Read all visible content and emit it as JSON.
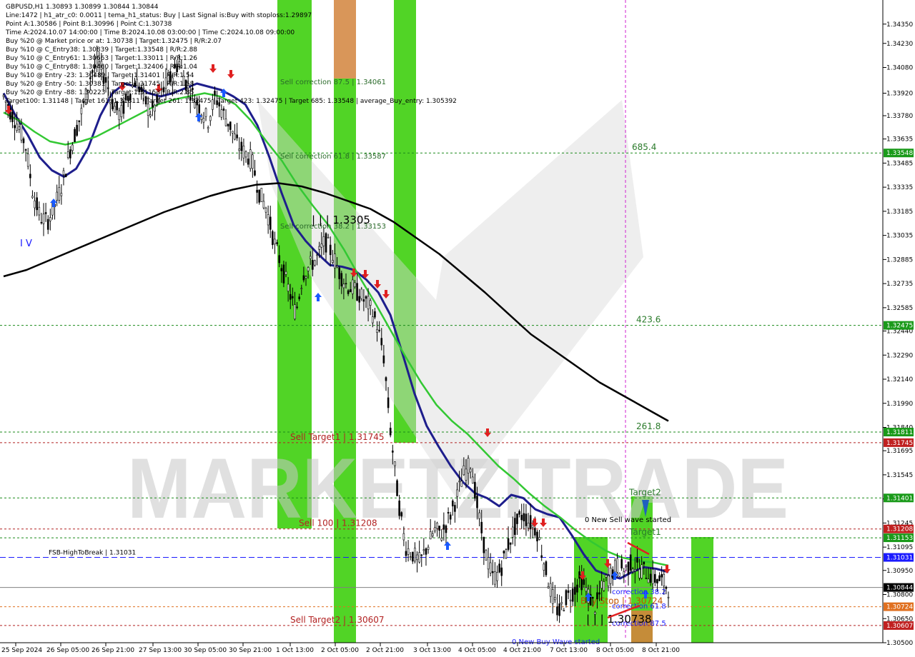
{
  "header": {
    "symbol_line": "GBPUSD,H1  1.30893 1.30899 1.30844 1.30844",
    "info_lines": [
      "Line:1472  |  h1_atr_c0: 0.0011  |  tema_h1_status: Buy  |  Last Signal is:Buy with stoploss:1.29897",
      "Point A:1.30586  |  Point B:1.30996  |  Point C:1.30738",
      "Time A:2024.10.07 14:00:00  |  Time B:2024.10.08 03:00:00  |  Time C:2024.10.08 09:00:00",
      "Buy %20 @ Market price or at: 1.30738  |  Target:1.32475  |  R/R:2.07",
      "Buy %10 @ C_Entry38: 1.30839  |  Target:1.33548  |  R/R:2.88",
      "Buy %10 @ C_Entry61: 1.30663  |  Target:1.33011  |  R/R:1.26",
      "Buy %10 @ C_Entry88: 1.30460  |  Target:1.32406  |  R/R:1.04",
      "Buy %10 @ Entry -23: 1.30489  |  Target:1.31401  |  R/R:1.54",
      "Buy %20 @ Entry -50: 1.30381  |  Target:1.31745  |  R/R:1.58",
      "Buy %20 @ Entry -88: 1.30223  |  Target:1.31153  |  R/R:2.85",
      "Target100: 1.31148  |  Target 161: 1.31811  |  Target 261: 1.32475  |  Target 423: 1.32475  |  Target 685: 1.33548  |  average_Buy_entry: 1.305392"
    ]
  },
  "watermark": "MARKETZITRADE",
  "colors": {
    "bull_zone": "#33cc00",
    "bear_zone": "#d2843c",
    "ema_fast": "#1e1e8c",
    "ema_mid": "#33c833",
    "ema_slow": "#000000",
    "level_green": "#1a8a1a",
    "level_red": "#b22222",
    "level_blue": "#1a1aff",
    "candle": "#000000"
  },
  "chart_data": {
    "type": "candlestick",
    "symbol": "GBPUSD",
    "timeframe": "H1",
    "ylim": [
      1.305,
      1.345
    ],
    "y_ticks": [
      "1.34350",
      "1.34230",
      "1.34080",
      "1.33920",
      "1.33780",
      "1.33635",
      "1.33485",
      "1.33335",
      "1.33185",
      "1.33035",
      "1.32885",
      "1.32735",
      "1.32585",
      "1.32440",
      "1.32290",
      "1.32140",
      "1.31990",
      "1.31840",
      "1.31695",
      "1.31545",
      "1.31395",
      "1.31245",
      "1.31095",
      "1.30950",
      "1.30800",
      "1.30650",
      "1.30500"
    ],
    "x_ticks": [
      "25 Sep 2024",
      "26 Sep 05:00",
      "26 Sep 21:00",
      "27 Sep 13:00",
      "30 Sep 05:00",
      "30 Sep 21:00",
      "1 Oct 13:00",
      "2 Oct 05:00",
      "2 Oct 21:00",
      "3 Oct 13:00",
      "4 Oct 05:00",
      "4 Oct 21:00",
      "7 Oct 13:00",
      "8 Oct 05:00",
      "8 Oct 21:00"
    ],
    "close_path": [
      1.339,
      1.338,
      1.3372,
      1.336,
      1.333,
      1.3315,
      1.3312,
      1.3322,
      1.3335,
      1.3355,
      1.337,
      1.3385,
      1.3405,
      1.341,
      1.34,
      1.3385,
      1.3378,
      1.339,
      1.34,
      1.3392,
      1.338,
      1.3385,
      1.3395,
      1.3402,
      1.3412,
      1.3398,
      1.339,
      1.3382,
      1.3375,
      1.339,
      1.338,
      1.3372,
      1.336,
      1.3355,
      1.335,
      1.333,
      1.332,
      1.33,
      1.3285,
      1.327,
      1.3255,
      1.328,
      1.3285,
      1.329,
      1.33,
      1.3292,
      1.328,
      1.3272,
      1.327,
      1.3265,
      1.326,
      1.325,
      1.323,
      1.318,
      1.314,
      1.311,
      1.3105,
      1.31,
      1.311,
      1.312,
      1.3118,
      1.3128,
      1.314,
      1.3155,
      1.3162,
      1.313,
      1.3105,
      1.309,
      1.3095,
      1.311,
      1.3122,
      1.313,
      1.3125,
      1.312,
      1.31,
      1.308,
      1.3068,
      1.3078,
      1.3082,
      1.309,
      1.308,
      1.3072,
      1.3085,
      1.3092,
      1.3098,
      1.3095,
      1.31,
      1.3096,
      1.3094,
      1.309,
      1.3089,
      1.3084
    ],
    "series": [
      {
        "name": "",
        "role": "ema_fast",
        "values": [
          1.3392,
          1.3378,
          1.3366,
          1.3352,
          1.3344,
          1.334,
          1.3345,
          1.3358,
          1.3378,
          1.3392,
          1.3398,
          1.3396,
          1.3392,
          1.339,
          1.3392,
          1.3395,
          1.3398,
          1.3396,
          1.3394,
          1.339,
          1.3385,
          1.3372,
          1.3352,
          1.333,
          1.331,
          1.33,
          1.3292,
          1.3285,
          1.3284,
          1.3282,
          1.3276,
          1.3268,
          1.3254,
          1.323,
          1.3205,
          1.3185,
          1.3172,
          1.316,
          1.315,
          1.3143,
          1.314,
          1.3135,
          1.3142,
          1.314,
          1.3133,
          1.313,
          1.3128,
          1.3117,
          1.3105,
          1.3095,
          1.3092,
          1.309,
          1.3094,
          1.3097,
          1.3096,
          1.3094
        ]
      },
      {
        "name": "",
        "role": "ema_mid",
        "values": [
          1.338,
          1.3375,
          1.3368,
          1.3362,
          1.336,
          1.3362,
          1.3365,
          1.337,
          1.3375,
          1.338,
          1.3385,
          1.3388,
          1.339,
          1.3392,
          1.339,
          1.3385,
          1.3375,
          1.3362,
          1.335,
          1.3335,
          1.3322,
          1.331,
          1.3295,
          1.3278,
          1.3262,
          1.3245,
          1.3228,
          1.3212,
          1.3198,
          1.3188,
          1.318,
          1.317,
          1.316,
          1.3152,
          1.3143,
          1.3135,
          1.3128,
          1.312,
          1.3113,
          1.3107,
          1.3103,
          1.3101,
          1.31,
          1.3098
        ]
      },
      {
        "name": "",
        "role": "ema_slow",
        "values": [
          1.3278,
          1.3282,
          1.3288,
          1.3294,
          1.33,
          1.3306,
          1.3312,
          1.3318,
          1.3323,
          1.3328,
          1.3332,
          1.3335,
          1.3336,
          1.3334,
          1.333,
          1.3325,
          1.332,
          1.3312,
          1.3302,
          1.3292,
          1.328,
          1.3268,
          1.3255,
          1.3242,
          1.3232,
          1.3222,
          1.3212,
          1.3204,
          1.3196,
          1.3188
        ]
      }
    ],
    "levels": [
      {
        "price": 1.33548,
        "badge": "1.33548",
        "color": "green",
        "label": "685.4"
      },
      {
        "price": 1.32475,
        "badge": "1.32475",
        "color": "green",
        "label": "423.6"
      },
      {
        "price": 1.31811,
        "badge": "1.31811",
        "color": "green",
        "label": "261.8"
      },
      {
        "price": 1.31745,
        "badge": "1.31745",
        "color": "red",
        "label": "Sell Target1 | 1.31745"
      },
      {
        "price": 1.31401,
        "badge": "1.31401",
        "color": "green",
        "label": "Target2"
      },
      {
        "price": 1.31208,
        "badge": "1.31208",
        "color": "red",
        "label": "Sell 100 | 1.31208"
      },
      {
        "price": 1.31153,
        "badge": "1.31153",
        "color": "green",
        "label": "Target1"
      },
      {
        "price": 1.31031,
        "badge": "1.31031",
        "color": "blue",
        "label": "FSB-HighToBreak | 1.31031"
      },
      {
        "price": 1.30844,
        "badge": "1.30844",
        "color": "current",
        "label": ""
      },
      {
        "price": 1.30724,
        "badge": "1.30724",
        "color": "orange",
        "label": "Buy Stop | 1.30724"
      },
      {
        "price": 1.30607,
        "badge": "1.30607",
        "color": "red",
        "label": "Sell Target2 | 1.30607"
      }
    ],
    "annotations": [
      "Sell correction 87.5 | 1.34061",
      "Sell correction 61.8 | 1.33587",
      "Sell correction 38.2 | 1.33153",
      "| | | 1.3305",
      "I V",
      "0 New Sell wave started",
      "0 New Buy Wave started",
      "correction 38.2",
      "correction 61.8",
      "correction 87.5",
      "| | | 1.30738"
    ],
    "grid": false,
    "legend": "none"
  }
}
